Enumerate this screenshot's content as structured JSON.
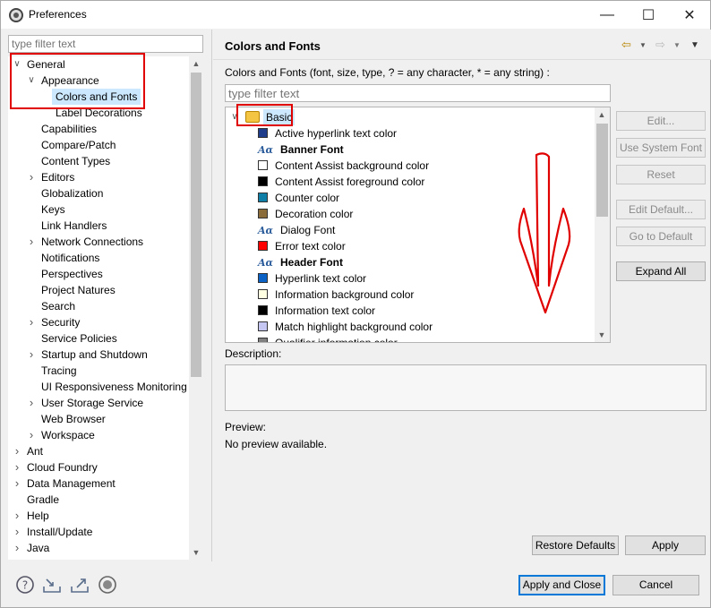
{
  "window": {
    "title": "Preferences",
    "min": "—",
    "max": "☐",
    "close": "✕"
  },
  "left": {
    "filter_placeholder": "type filter text",
    "tree": [
      {
        "label": "General",
        "expanded": true
      },
      {
        "label": "Appearance",
        "expanded": true
      },
      {
        "label": "Colors and Fonts",
        "selected": true
      },
      {
        "label": "Label Decorations"
      },
      {
        "label": "Capabilities"
      },
      {
        "label": "Compare/Patch"
      },
      {
        "label": "Content Types"
      },
      {
        "label": "Editors",
        "collapsed": true
      },
      {
        "label": "Globalization"
      },
      {
        "label": "Keys"
      },
      {
        "label": "Link Handlers"
      },
      {
        "label": "Network Connections",
        "collapsed": true
      },
      {
        "label": "Notifications"
      },
      {
        "label": "Perspectives"
      },
      {
        "label": "Project Natures"
      },
      {
        "label": "Search"
      },
      {
        "label": "Security",
        "collapsed": true
      },
      {
        "label": "Service Policies"
      },
      {
        "label": "Startup and Shutdown",
        "collapsed": true
      },
      {
        "label": "Tracing"
      },
      {
        "label": "UI Responsiveness Monitoring"
      },
      {
        "label": "User Storage Service",
        "collapsed": true
      },
      {
        "label": "Web Browser"
      },
      {
        "label": "Workspace",
        "collapsed": true
      },
      {
        "label": "Ant",
        "collapsed": true
      },
      {
        "label": "Cloud Foundry",
        "collapsed": true
      },
      {
        "label": "Data Management",
        "collapsed": true
      },
      {
        "label": "Gradle"
      },
      {
        "label": "Help",
        "collapsed": true
      },
      {
        "label": "Install/Update",
        "collapsed": true
      },
      {
        "label": "Java",
        "collapsed": true
      }
    ]
  },
  "right": {
    "title": "Colors and Fonts",
    "instruction": "Colors and Fonts (font, size, type, ? = any character, * = any string) :",
    "filter_placeholder": "type filter text",
    "category": "Basic",
    "items": [
      {
        "label": "Active hyperlink text color",
        "kind": "color",
        "color": "#1f3d8a"
      },
      {
        "label": "Banner Font",
        "kind": "font",
        "bold": true
      },
      {
        "label": "Content Assist background color",
        "kind": "color",
        "color": "#ffffff"
      },
      {
        "label": "Content Assist foreground color",
        "kind": "color",
        "color": "#000000"
      },
      {
        "label": "Counter color",
        "kind": "color",
        "color": "#0f7fa8"
      },
      {
        "label": "Decoration color",
        "kind": "color",
        "color": "#8a6d3b"
      },
      {
        "label": "Dialog Font",
        "kind": "font"
      },
      {
        "label": "Error text color",
        "kind": "color",
        "color": "#ff0000"
      },
      {
        "label": "Header Font",
        "kind": "font",
        "bold": true
      },
      {
        "label": "Hyperlink text color",
        "kind": "color",
        "color": "#0b62c4"
      },
      {
        "label": "Information background color",
        "kind": "color",
        "color": "#ffffe1"
      },
      {
        "label": "Information text color",
        "kind": "color",
        "color": "#000000"
      },
      {
        "label": "Match highlight background color",
        "kind": "color",
        "color": "#c6c6f2"
      },
      {
        "label": "Qualifier information color",
        "kind": "color",
        "color": "#808080"
      }
    ],
    "buttons": {
      "edit": "Edit...",
      "use_system_font": "Use System Font",
      "reset": "Reset",
      "edit_default": "Edit Default...",
      "go_to_default": "Go to Default",
      "expand_all": "Expand All"
    },
    "description_label": "Description:",
    "preview_label": "Preview:",
    "preview_text": "No preview available.",
    "restore_defaults": "Restore Defaults",
    "apply": "Apply"
  },
  "footer": {
    "apply_and_close": "Apply and Close",
    "cancel": "Cancel",
    "icons": [
      "help-icon",
      "import-icon",
      "export-icon",
      "oomph-icon"
    ]
  },
  "accent_colors": {
    "selection": "#cce8ff",
    "annotation": "#e00000",
    "focus": "#0078d7"
  }
}
